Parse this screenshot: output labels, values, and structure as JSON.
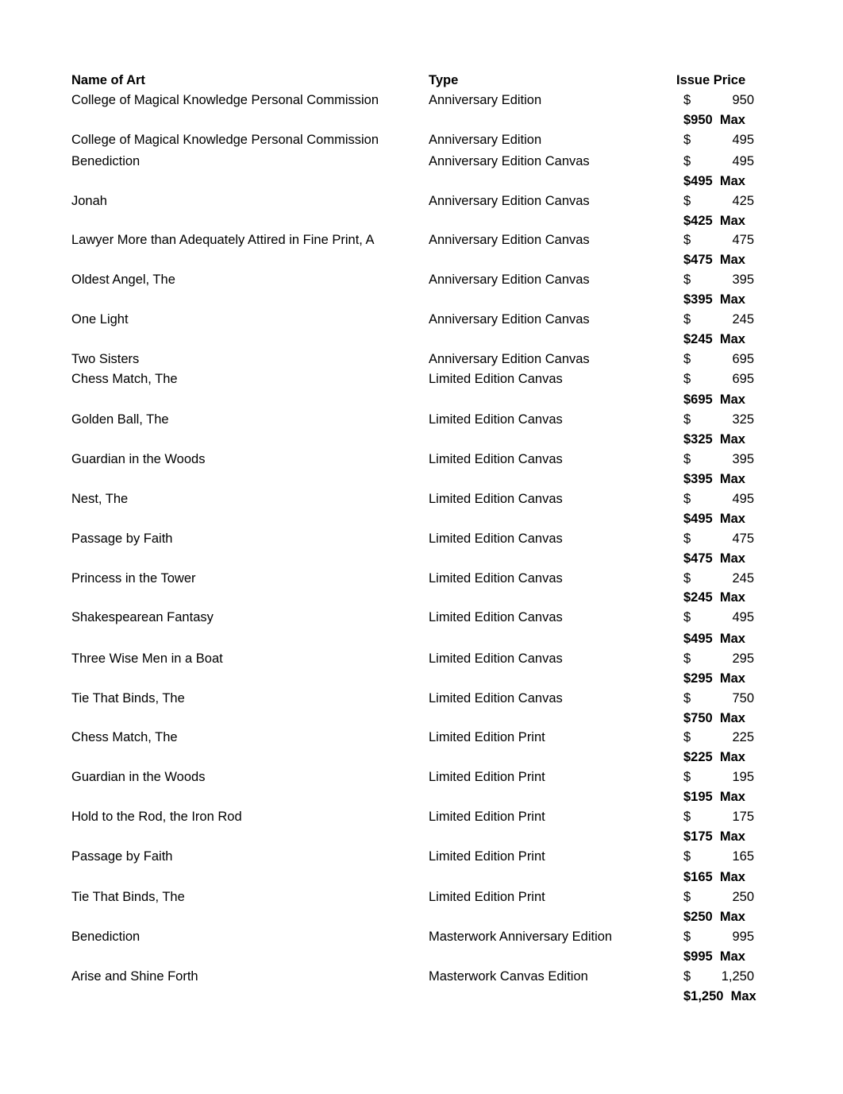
{
  "headers": {
    "name": "Name of Art",
    "type": "Type",
    "price": "Issue Price"
  },
  "currency_symbol": "$",
  "rows": [
    {
      "name": "College of Magical Knowledge Personal Commission",
      "type": "Anniversary Edition",
      "price": "950"
    },
    {
      "name": "College of Magical Knowledge Personal Commission",
      "type": "Anniversary Edition",
      "price": "495"
    },
    {
      "name": "Benediction",
      "type": "Anniversary Edition Canvas",
      "price": "495"
    },
    {
      "name": "Jonah",
      "type": "Anniversary Edition Canvas",
      "price": "425"
    },
    {
      "name": "Lawyer More than Adequately Attired in Fine Print, A",
      "type": "Anniversary Edition Canvas",
      "price": "475"
    },
    {
      "name": "Oldest Angel, The",
      "type": "Anniversary Edition Canvas",
      "price": "395"
    },
    {
      "name": "One Light",
      "type": "Anniversary Edition Canvas",
      "price": "245"
    },
    {
      "name": "Two Sisters",
      "type": "Anniversary Edition Canvas",
      "price": "695"
    },
    {
      "name": "Chess Match, The",
      "type": "Limited Edition Canvas",
      "price": "695"
    },
    {
      "name": "Golden Ball, The",
      "type": "Limited Edition Canvas",
      "price": "325"
    },
    {
      "name": "Guardian in the Woods",
      "type": "Limited Edition Canvas",
      "price": "395"
    },
    {
      "name": "Nest, The",
      "type": "Limited Edition Canvas",
      "price": "495"
    },
    {
      "name": "Passage by Faith",
      "type": "Limited Edition Canvas",
      "price": "475"
    },
    {
      "name": "Princess in the Tower",
      "type": "Limited Edition Canvas",
      "price": "245"
    },
    {
      "name": "Shakespearean Fantasy",
      "type": "Limited Edition Canvas",
      "price": "495"
    },
    {
      "name": "Three Wise Men in a Boat",
      "type": "Limited Edition Canvas",
      "price": "295"
    },
    {
      "name": "Tie That Binds, The",
      "type": "Limited Edition Canvas",
      "price": "750"
    },
    {
      "name": "Chess Match, The",
      "type": "Limited Edition Print",
      "price": "225"
    },
    {
      "name": "Guardian in the Woods",
      "type": "Limited Edition Print",
      "price": "195"
    },
    {
      "name": "Hold to the Rod, the Iron Rod",
      "type": "Limited Edition Print",
      "price": "175"
    },
    {
      "name": "Passage by Faith",
      "type": "Limited Edition Print",
      "price": "165"
    },
    {
      "name": "Tie That Binds, The",
      "type": "Limited Edition Print",
      "price": "250"
    },
    {
      "name": "Benediction",
      "type": "Masterwork Anniversary Edition",
      "price": "995"
    },
    {
      "name": "Arise and Shine Forth",
      "type": "Masterwork Canvas Edition",
      "price": "1,250"
    }
  ],
  "max_lines": [
    "$950  Max",
    "$495  Max",
    "$425  Max",
    "$475  Max",
    "$395  Max",
    "$245  Max",
    "$695  Max",
    "$325  Max",
    "$395  Max",
    "$495  Max",
    "$475  Max",
    "$245  Max",
    "$495  Max",
    "$295  Max",
    "$750  Max",
    "$225  Max",
    "$195  Max",
    "$175  Max",
    "$165  Max",
    "$250  Max",
    "$995  Max",
    "$1,250  Max"
  ]
}
